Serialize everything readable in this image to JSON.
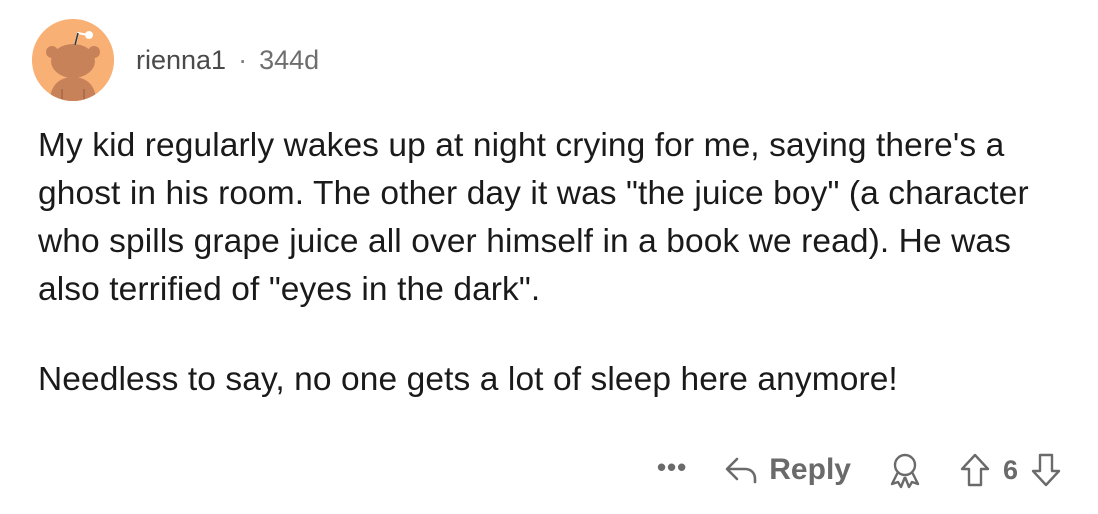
{
  "comment": {
    "username": "rienna1",
    "separator": "·",
    "age": "344d",
    "paragraphs": [
      "My kid regularly wakes up at night crying for me, saying there's a ghost in his room. The other day it was \"the juice boy\" (a character who spills grape juice all over himself in a book we read). He was also terrified of \"eyes in the dark\".",
      "Needless to say, no one gets a lot of sleep here anymore!"
    ]
  },
  "actions": {
    "more_label": "•••",
    "reply_label": "Reply",
    "score": "6"
  },
  "colors": {
    "avatar_bg": "#f9b074",
    "avatar_figure": "#c8825a",
    "text": "#1a1a1b",
    "muted": "#6a6a6a"
  },
  "icons": {
    "avatar": "reddit-snoo-avatar",
    "reply": "reply-arrow-icon",
    "award": "award-icon",
    "upvote": "upvote-arrow-icon",
    "downvote": "downvote-arrow-icon"
  }
}
